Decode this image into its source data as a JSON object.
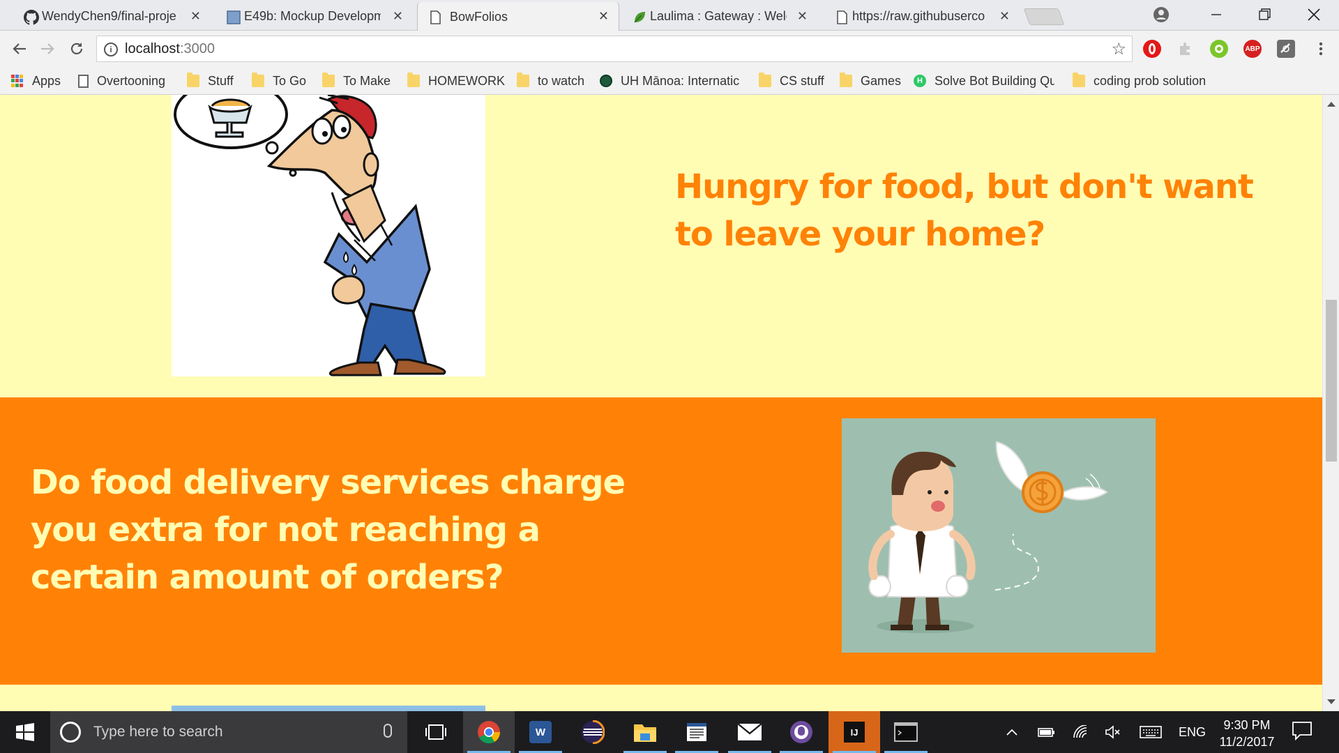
{
  "browser": {
    "tabs": [
      {
        "title": "WendyChen9/final-proje",
        "favicon": "github-icon",
        "active": false
      },
      {
        "title": "E49b: Mockup Developm",
        "favicon": "page-blue-icon",
        "active": false
      },
      {
        "title": "BowFolios",
        "favicon": "page-icon",
        "active": true
      },
      {
        "title": "Laulima : Gateway : Welc",
        "favicon": "leaf-icon",
        "active": false
      },
      {
        "title": "https://raw.githubuserco",
        "favicon": "page-icon",
        "active": false
      }
    ],
    "address": {
      "host": "localhost",
      "port": ":3000"
    },
    "extensions": [
      "opera-icon",
      "puzzle-icon",
      "q-icon",
      "adblock-icon",
      "camera-icon"
    ],
    "adblock_label": "ABP",
    "bookmarks": [
      {
        "label": "Apps",
        "icon": "apps-icon"
      },
      {
        "label": "Overtooning",
        "icon": "page-icon"
      },
      {
        "label": "Stuff",
        "icon": "folder-icon"
      },
      {
        "label": "To Go",
        "icon": "folder-icon"
      },
      {
        "label": "To Make",
        "icon": "folder-icon"
      },
      {
        "label": "HOMEWORK",
        "icon": "folder-icon"
      },
      {
        "label": "to watch",
        "icon": "folder-icon"
      },
      {
        "label": "UH Mānoa: Internatic",
        "icon": "uh-seal-icon"
      },
      {
        "label": "CS stuff",
        "icon": "folder-icon"
      },
      {
        "label": "Games",
        "icon": "folder-icon"
      },
      {
        "label": "Solve Bot Building Qu",
        "icon": "hackerrank-icon"
      },
      {
        "label": "coding prob solution",
        "icon": "folder-icon"
      }
    ]
  },
  "page": {
    "section1": {
      "heading": "Hungry for food, but don't want to leave your home?"
    },
    "section2": {
      "heading": "Do food delivery services charge you extra for not reaching a certain amount of orders?"
    },
    "colors": {
      "accent_orange": "#ff8207",
      "cream": "#fffdb4",
      "image_teal": "#9ebfaf"
    }
  },
  "taskbar": {
    "search_placeholder": "Type here to search",
    "apps": [
      "task-view-icon",
      "chrome-icon",
      "word-icon",
      "eclipse-icon",
      "file-explorer-icon",
      "news-icon",
      "mail-icon",
      "github-desktop-icon",
      "intellij-icon",
      "terminal-icon"
    ],
    "word_letter": "W",
    "intellij_letters": "IJ",
    "language": "ENG",
    "time": "9:30 PM",
    "date": "11/2/2017"
  }
}
